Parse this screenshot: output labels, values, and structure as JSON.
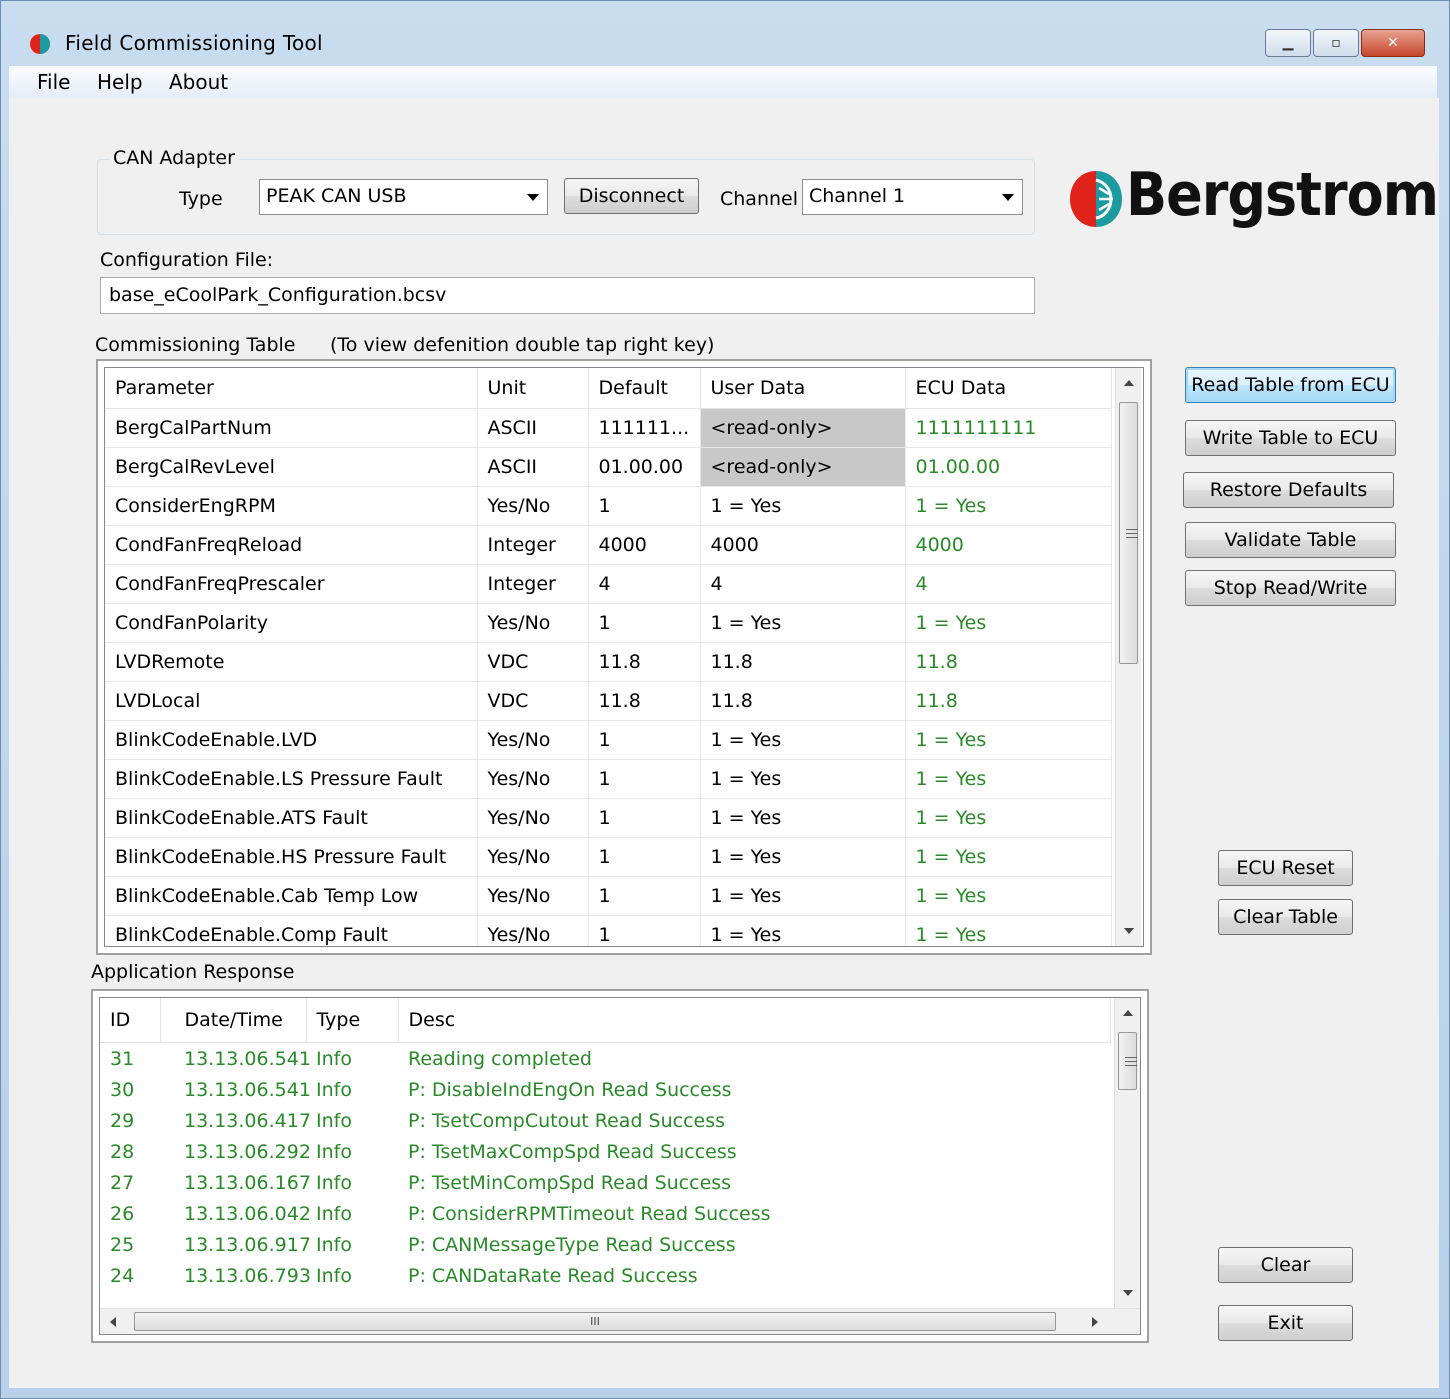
{
  "window": {
    "title": "Field Commissioning Tool",
    "min_glyph": "▁",
    "max_glyph": "▫",
    "close_glyph": "✕"
  },
  "menu": [
    "File",
    "Help",
    "About"
  ],
  "can_adapter": {
    "group_label": "CAN Adapter",
    "type_label": "Type",
    "type_value": "PEAK CAN USB",
    "disconnect_label": "Disconnect",
    "channel_label": "Channel",
    "channel_value": "Channel 1"
  },
  "brand": {
    "name": "Bergstrom",
    "colors": {
      "red": "#e0231a",
      "teal": "#1b9aa0"
    }
  },
  "config": {
    "label": "Configuration File:",
    "value": "base_eCoolPark_Configuration.bcsv"
  },
  "commissioning": {
    "label": "Commissioning Table",
    "hint": "(To view defenition double tap right key)",
    "columns": [
      "Parameter",
      "Unit",
      "Default",
      "User Data",
      "ECU Data"
    ],
    "rows": [
      [
        "BergCalPartNum",
        "ASCII",
        "111111...",
        "<read-only>",
        "1111111111"
      ],
      [
        "BergCalRevLevel",
        "ASCII",
        "01.00.00",
        "<read-only>",
        "01.00.00"
      ],
      [
        "ConsiderEngRPM",
        "Yes/No",
        "1",
        "1 = Yes",
        "1 = Yes"
      ],
      [
        "CondFanFreqReload",
        "Integer",
        "4000",
        "4000",
        "4000"
      ],
      [
        "CondFanFreqPrescaler",
        "Integer",
        "4",
        "4",
        "4"
      ],
      [
        "CondFanPolarity",
        "Yes/No",
        "1",
        "1 = Yes",
        "1 = Yes"
      ],
      [
        "LVDRemote",
        "VDC",
        "11.8",
        "11.8",
        "11.8"
      ],
      [
        "LVDLocal",
        "VDC",
        "11.8",
        "11.8",
        "11.8"
      ],
      [
        "BlinkCodeEnable.LVD",
        "Yes/No",
        "1",
        "1 = Yes",
        "1 = Yes"
      ],
      [
        "BlinkCodeEnable.LS Pressure Fault",
        "Yes/No",
        "1",
        "1 = Yes",
        "1 = Yes"
      ],
      [
        "BlinkCodeEnable.ATS Fault",
        "Yes/No",
        "1",
        "1 = Yes",
        "1 = Yes"
      ],
      [
        "BlinkCodeEnable.HS Pressure Fault",
        "Yes/No",
        "1",
        "1 = Yes",
        "1 = Yes"
      ],
      [
        "BlinkCodeEnable.Cab Temp Low",
        "Yes/No",
        "1",
        "1 = Yes",
        "1 = Yes"
      ],
      [
        "BlinkCodeEnable.Comp Fault",
        "Yes/No",
        "1",
        "1 = Yes",
        "1 = Yes"
      ]
    ]
  },
  "buttons": {
    "read_table": "Read Table from ECU",
    "write_table": "Write Table to ECU",
    "restore_defaults": "Restore Defaults",
    "validate_table": "Validate Table",
    "stop_rw": "Stop Read/Write",
    "ecu_reset": "ECU Reset",
    "clear_table": "Clear Table",
    "clear": "Clear",
    "exit": "Exit"
  },
  "response": {
    "label": "Application Response",
    "columns": [
      "ID",
      "Date/Time",
      "Type",
      "Desc"
    ],
    "rows": [
      [
        "31",
        "13.13.06.541",
        "Info",
        "Reading completed"
      ],
      [
        "30",
        "13.13.06.541",
        "Info",
        "P: DisableIndEngOn Read Success"
      ],
      [
        "29",
        "13.13.06.417",
        "Info",
        "P: TsetCompCutout Read Success"
      ],
      [
        "28",
        "13.13.06.292",
        "Info",
        "P: TsetMaxCompSpd Read Success"
      ],
      [
        "27",
        "13.13.06.167",
        "Info",
        "P: TsetMinCompSpd Read Success"
      ],
      [
        "26",
        "13.13.06.042",
        "Info",
        "P: ConsiderRPMTimeout Read Success"
      ],
      [
        "25",
        "13.13.06.917",
        "Info",
        "P: CANMessageType Read Success"
      ],
      [
        "24",
        "13.13.06.793",
        "Info",
        "P: CANDataRate Read Success"
      ]
    ],
    "hscroll_grip": "III"
  },
  "colors": {
    "ecu_green": "#2a8a2a",
    "readonly_gray": "#c8c8c8",
    "focus_blue": "#3c7fb1"
  }
}
